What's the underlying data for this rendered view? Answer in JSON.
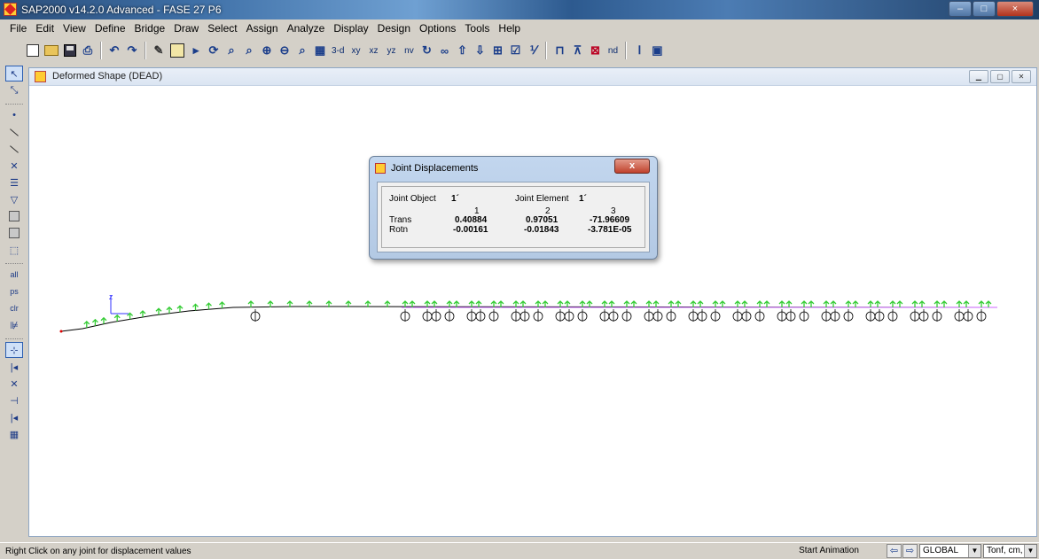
{
  "window": {
    "title": "SAP2000 v14.2.0 Advanced  - FASE 27 P6",
    "buttons": {
      "minimize": "–",
      "maximize": "□",
      "close": "×"
    }
  },
  "menu": {
    "items": [
      {
        "label": "File",
        "key": "F"
      },
      {
        "label": "Edit",
        "key": "E"
      },
      {
        "label": "View",
        "key": "V"
      },
      {
        "label": "Define",
        "key": "D"
      },
      {
        "label": "Bridge",
        "key": "B"
      },
      {
        "label": "Draw",
        "key": "r"
      },
      {
        "label": "Select",
        "key": "S"
      },
      {
        "label": "Assign",
        "key": "A"
      },
      {
        "label": "Analyze",
        "key": "n"
      },
      {
        "label": "Display",
        "key": "y"
      },
      {
        "label": "Design",
        "key": "g"
      },
      {
        "label": "Options",
        "key": "O"
      },
      {
        "label": "Tools",
        "key": "T"
      },
      {
        "label": "Help",
        "key": "H"
      }
    ]
  },
  "toolbar": {
    "view_3d": "3-d",
    "view_xy": "xy",
    "view_xz": "xz",
    "view_yz": "yz",
    "view_nv": "nv",
    "nd": "nd"
  },
  "view_window": {
    "title": "Deformed Shape (DEAD)"
  },
  "dialog": {
    "title": "Joint Displacements",
    "close_label": "x",
    "joint_object_label": "Joint Object",
    "joint_object_value": "1´",
    "joint_element_label": "Joint Element",
    "joint_element_value": "1´",
    "columns": [
      "1",
      "2",
      "3"
    ],
    "rows": [
      {
        "label": "Trans",
        "values": [
          "0.40884",
          "0.97051",
          "-71.96609"
        ]
      },
      {
        "label": "Rotn",
        "values": [
          "-0.00161",
          "-0.01843",
          "-3.781E-05"
        ]
      }
    ]
  },
  "status": {
    "hint": "Right Click on any joint for displacement values",
    "start_animation": "Start Animation",
    "coord_system": "GLOBAL",
    "units": "Tonf, cm, C"
  },
  "colors": {
    "deck_line": "#000000",
    "support_green": "#33cc33",
    "frame_line": "#cc66ff",
    "axis_blue": "#3333ff"
  }
}
